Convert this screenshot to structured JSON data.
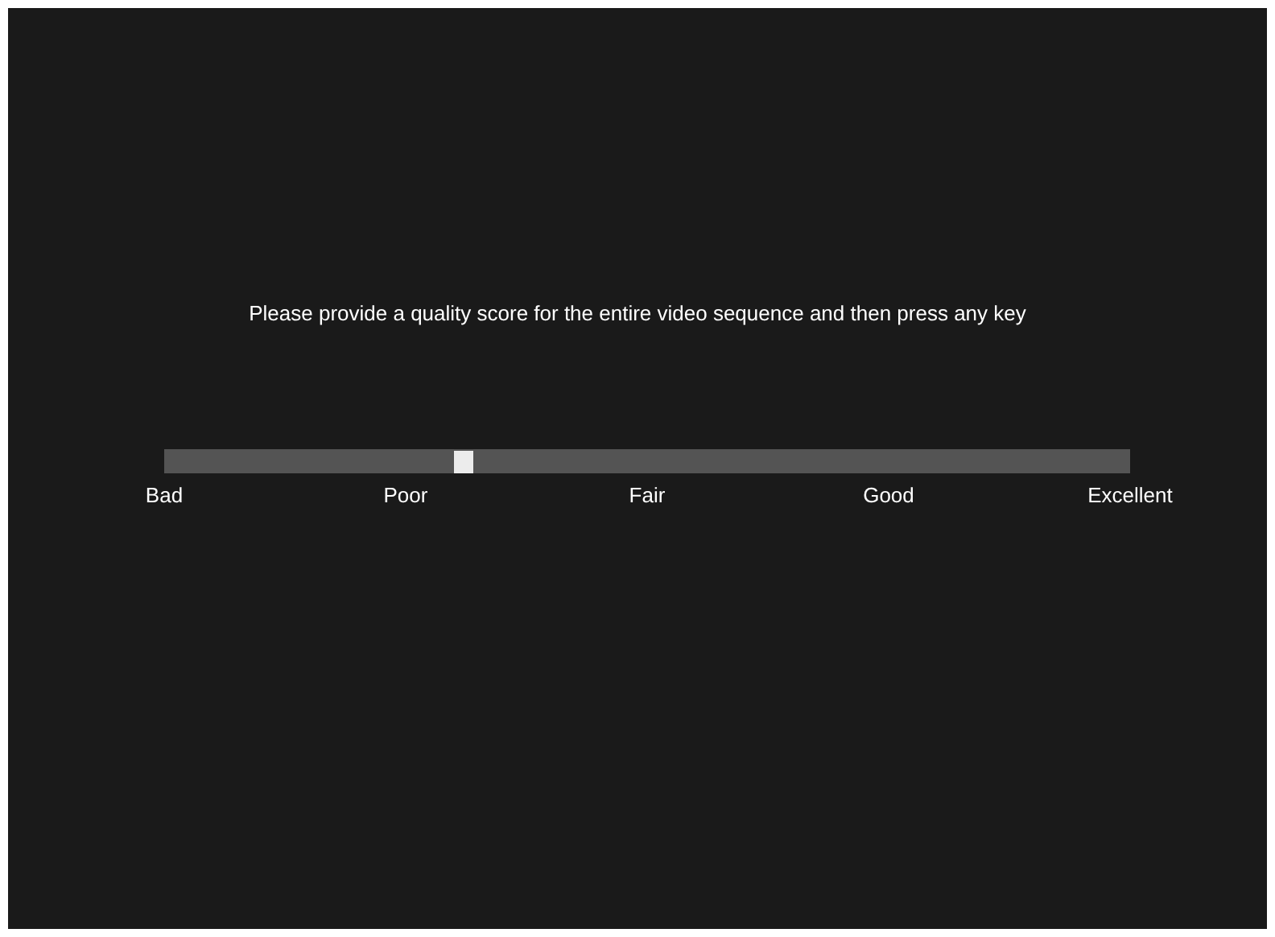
{
  "prompt": "Please provide a quality score for the entire video sequence and then press any key",
  "slider": {
    "level": 0.31,
    "labels": [
      "Bad",
      "Poor",
      "Fair",
      "Good",
      "Excellent"
    ]
  }
}
